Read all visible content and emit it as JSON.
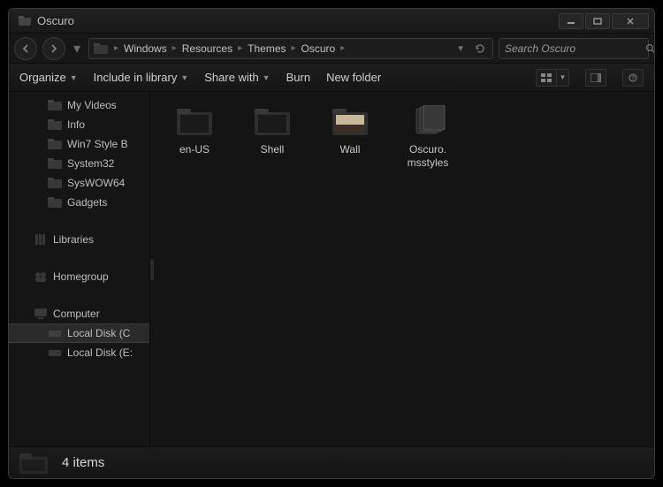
{
  "window": {
    "title": "Oscuro"
  },
  "breadcrumb": [
    {
      "label": "Windows"
    },
    {
      "label": "Resources"
    },
    {
      "label": "Themes"
    },
    {
      "label": "Oscuro"
    }
  ],
  "search": {
    "placeholder": "Search Oscuro"
  },
  "toolbar": {
    "organize": "Organize",
    "include": "Include in library",
    "share": "Share with",
    "burn": "Burn",
    "newfolder": "New folder"
  },
  "sidebar": {
    "items_top": [
      {
        "label": "My Videos"
      },
      {
        "label": "Info"
      },
      {
        "label": "Win7 Style B"
      },
      {
        "label": "System32"
      },
      {
        "label": "SysWOW64"
      },
      {
        "label": "Gadgets"
      }
    ],
    "libraries": "Libraries",
    "homegroup": "Homegroup",
    "computer": "Computer",
    "disks": [
      {
        "label": "Local Disk (C"
      },
      {
        "label": "Local Disk (E:"
      }
    ]
  },
  "files": [
    {
      "name": "en-US",
      "type": "folder"
    },
    {
      "name": "Shell",
      "type": "folder"
    },
    {
      "name": "Wall",
      "type": "folder-image"
    },
    {
      "name": "Oscuro.\nmsstyles",
      "type": "stack"
    }
  ],
  "status": {
    "text": "4 items"
  }
}
